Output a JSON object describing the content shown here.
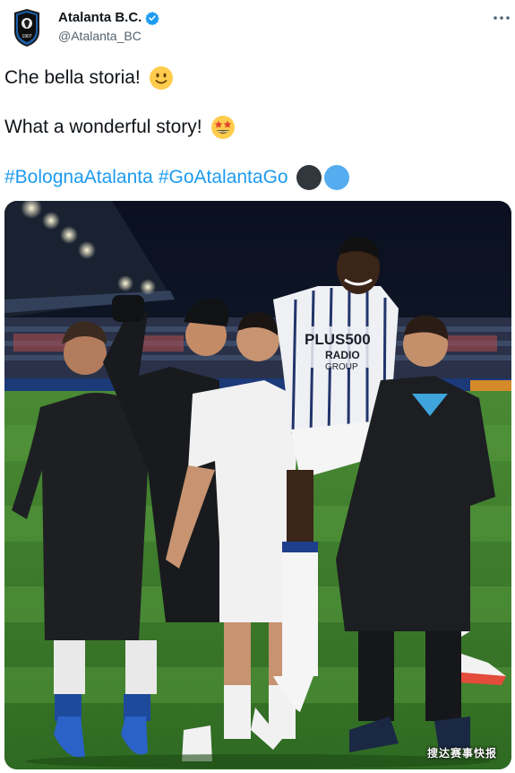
{
  "author": {
    "display_name": "Atalanta B.C.",
    "handle": "@Atalanta_BC",
    "verified": true,
    "avatar_text": "1907"
  },
  "tweet": {
    "line1": "Che bella storia!",
    "line1_emoji": "slightly-smiling-face",
    "line2": "What a wonderful story!",
    "line2_emoji": "star-struck",
    "hashtags": [
      "#BolognaAtalanta",
      "#GoAtalantaGo"
    ],
    "hashtag_emojis": [
      "black-circle",
      "blue-circle"
    ]
  },
  "media": {
    "jersey_text_line1": "PLUS500",
    "jersey_text_line2": "RADIO",
    "jersey_text_line3": "GROUP",
    "watermark": "搜达赛事快报"
  },
  "colors": {
    "link": "#1d9bf0",
    "text": "#0f1419",
    "secondary": "#536471",
    "pitch": "#3f7d2e"
  }
}
